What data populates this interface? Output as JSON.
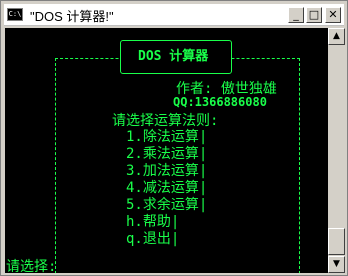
{
  "window": {
    "title": "\"DOS 计算器!\"",
    "icon_label": "C:\\",
    "controls": {
      "minimize": "_",
      "maximize": "□",
      "close": "✕"
    }
  },
  "console": {
    "header": "DOS 计算器",
    "author": "作者: 傲世独雄",
    "qq": "QQ:1366886080",
    "menu_title": "请选择运算法则:",
    "menu_items": [
      "1.除法运算|",
      "2.乘法运算|",
      "3.加法运算|",
      "4.减法运算|",
      "5.求余运算|",
      "h.帮助|",
      "q.退出|"
    ],
    "prompt": "请选择:"
  },
  "colors": {
    "console_text": "#19ff4a",
    "console_bg": "#000000"
  },
  "icons": {
    "app": "console-icon",
    "scroll_up": "arrow-up-icon",
    "scroll_down": "arrow-down-icon"
  }
}
